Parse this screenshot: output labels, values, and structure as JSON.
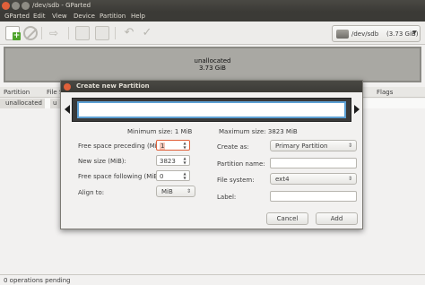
{
  "window": {
    "title": "/dev/sdb - GParted"
  },
  "menu": [
    "GParted",
    "Edit",
    "View",
    "Device",
    "Partition",
    "Help"
  ],
  "toolbar": {
    "icons": [
      "new-partition-icon",
      "delete-icon",
      "resize-icon",
      "copy-icon",
      "paste-icon",
      "undo-icon",
      "apply-icon"
    ]
  },
  "device": {
    "name": "/dev/sdb",
    "size": "(3.73 GiB)"
  },
  "diskmap": {
    "label": "unallocated",
    "size": "3.73 GiB"
  },
  "table": {
    "headers": [
      "Partition",
      "File S",
      "Flags"
    ],
    "rows": [
      {
        "partition": "unallocated",
        "fs": "u"
      }
    ]
  },
  "status": "0 operations pending",
  "dialog": {
    "title": "Create new Partition",
    "min_size": "Minimum size: 1 MiB",
    "max_size": "Maximum size: 3823 MiB",
    "left": {
      "free_before_label": "Free space preceding (MiB):",
      "free_before_value": "1",
      "new_size_label": "New size (MiB):",
      "new_size_value": "3823",
      "free_after_label": "Free space following (MiB):",
      "free_after_value": "0",
      "align_label": "Align to:",
      "align_value": "MiB"
    },
    "right": {
      "create_as_label": "Create as:",
      "create_as_value": "Primary Partition",
      "name_label": "Partition name:",
      "name_value": "",
      "fs_label": "File system:",
      "fs_value": "ext4",
      "label_label": "Label:",
      "label_value": ""
    },
    "cancel": "Cancel",
    "add": "Add"
  }
}
